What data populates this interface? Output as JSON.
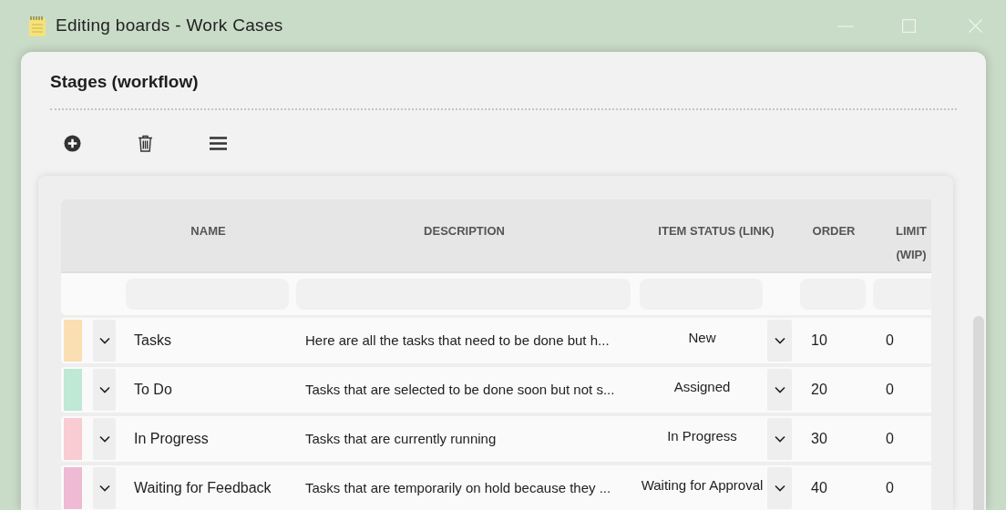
{
  "window": {
    "title": "Editing boards - Work Cases"
  },
  "panel": {
    "title": "Stages (workflow)"
  },
  "table": {
    "columns": [
      {
        "label": "NAME"
      },
      {
        "label": "DESCRIPTION"
      },
      {
        "label": "ITEM STATUS (LINK)"
      },
      {
        "label": "ORDER"
      },
      {
        "label": "LIMIT (WIP)"
      }
    ],
    "rows": [
      {
        "color": "#f9dfb2",
        "name": "Tasks",
        "description": "Here are all the tasks that need to be done but h...",
        "status": "New",
        "order": "10",
        "limit": "0"
      },
      {
        "color": "#bfe8d5",
        "name": "To Do",
        "description": "Tasks that are selected to be done soon but not s...",
        "status": "Assigned",
        "order": "20",
        "limit": "0"
      },
      {
        "color": "#f8ccd2",
        "name": "In Progress",
        "description": "Tasks that are currently running",
        "status": "In Progress",
        "order": "30",
        "limit": "0"
      },
      {
        "color": "#efbad3",
        "name": "Waiting for Feedback",
        "description": "Tasks that are temporarily on hold because they ...",
        "status": "Waiting for Approval",
        "order": "40",
        "limit": "0"
      }
    ]
  }
}
